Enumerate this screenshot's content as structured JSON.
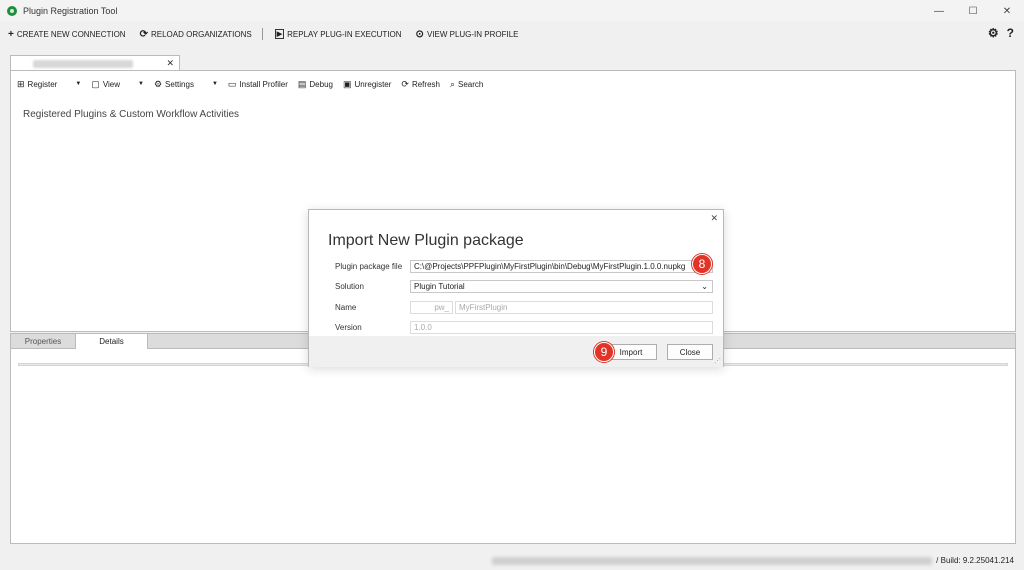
{
  "window": {
    "title": "Plugin Registration Tool",
    "controls": {
      "minimize": "—",
      "maximize": "☐",
      "close": "✕"
    }
  },
  "menubar": {
    "create_connection": {
      "icon": "+",
      "label": "CREATE NEW CONNECTION"
    },
    "reload_orgs": {
      "icon": "⟳",
      "label": "RELOAD ORGANIZATIONS"
    },
    "replay": {
      "icon": "▶",
      "label": "REPLAY PLUG-IN EXECUTION"
    },
    "view_profile": {
      "icon": "⊙",
      "label": "VIEW PLUG-IN PROFILE"
    },
    "settings_icon": "⚙",
    "help_icon": "?"
  },
  "connection_tab": {
    "close": "✕"
  },
  "toolbar": {
    "register": "Register",
    "view": "View",
    "settings": "Settings",
    "install_profiler": "Install Profiler",
    "debug": "Debug",
    "unregister": "Unregister",
    "refresh": "Refresh",
    "search": "Search",
    "caret": "▼"
  },
  "tree": {
    "root_label": "Registered Plugins & Custom Workflow Activities"
  },
  "bottom_tabs": [
    {
      "label": "Properties"
    },
    {
      "label": "Details"
    }
  ],
  "status": {
    "build": "/ Build: 9.2.25041.214"
  },
  "dialog": {
    "title": "Import New Plugin package",
    "close": "✕",
    "fields": {
      "package_file": {
        "label": "Plugin package file",
        "value": "C:\\@Projects\\PPFPlugin\\MyFirstPlugin\\bin\\Debug\\MyFirstPlugin.1.0.0.nupkg"
      },
      "solution": {
        "label": "Solution",
        "value": "Plugin Tutorial"
      },
      "name": {
        "label": "Name",
        "prefix": "pw_",
        "value": "MyFirstPlugin"
      },
      "version": {
        "label": "Version",
        "value": "1.0.0"
      }
    },
    "buttons": {
      "import": "Import",
      "close": "Close"
    }
  },
  "annotations": {
    "step8": "8",
    "step9": "9"
  },
  "colors": {
    "badge": "#e03428",
    "app_icon": "#1e8e3e"
  }
}
